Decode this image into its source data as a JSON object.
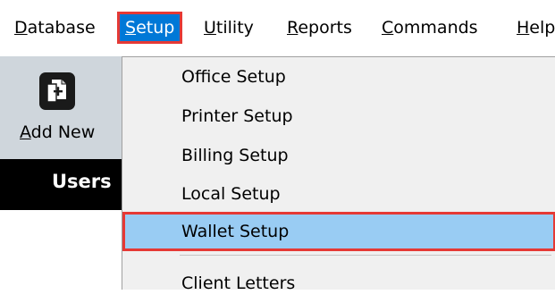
{
  "menubar": {
    "items": [
      {
        "first": "D",
        "rest": "atabase"
      },
      {
        "first": "S",
        "rest": "etup"
      },
      {
        "first": "U",
        "rest": "tility"
      },
      {
        "first": "R",
        "rest": "eports"
      },
      {
        "first": "C",
        "rest": "ommands"
      },
      {
        "first": "H",
        "rest": "elp"
      }
    ]
  },
  "toolbar": {
    "add_new": {
      "first": "A",
      "rest": "dd New"
    }
  },
  "section": {
    "title": "Users"
  },
  "dropdown": {
    "items": [
      {
        "label": "Office Setup"
      },
      {
        "label": "Printer Setup"
      },
      {
        "label": "Billing Setup"
      },
      {
        "label": "Local Setup"
      },
      {
        "label": "Wallet Setup"
      },
      {
        "label": "Client Letters"
      }
    ]
  },
  "colors": {
    "menu_selected": "#0078d7",
    "highlight": "#99ccf3",
    "annotation_border": "#e53935",
    "toolbar_bg": "#cfd6dc",
    "dropdown_bg": "#f0f0f0"
  }
}
